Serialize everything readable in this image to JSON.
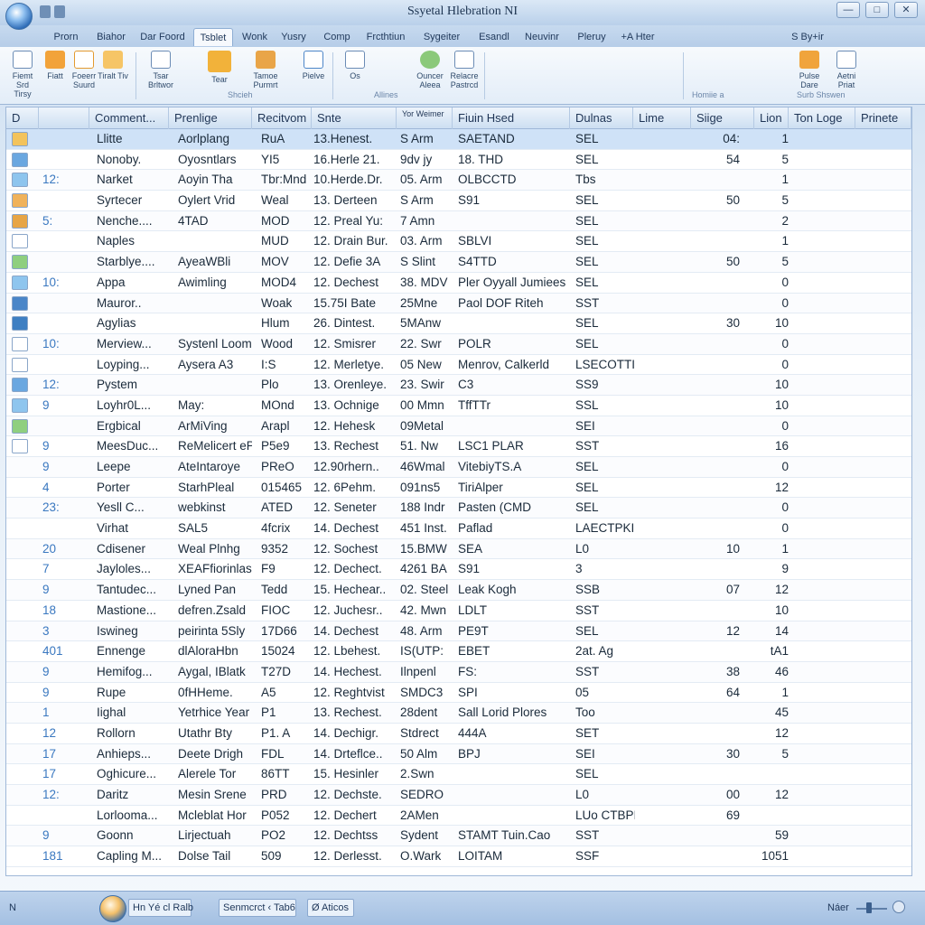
{
  "window": {
    "title": "Ssyetal Hlebration NI",
    "controls": [
      "—",
      "□",
      "✕"
    ]
  },
  "tabs": [
    {
      "label": "Prorn",
      "active": false
    },
    {
      "label": "Biahor",
      "active": false
    },
    {
      "label": "Dar Foord",
      "active": false
    },
    {
      "label": "Tsblet",
      "active": true
    },
    {
      "label": "Wonk",
      "active": false
    },
    {
      "label": "Yusry",
      "active": false
    },
    {
      "label": "Comp",
      "active": false
    },
    {
      "label": "Frcthtiun",
      "active": false
    },
    {
      "label": "Sygeiter",
      "active": false
    },
    {
      "label": "Esandl",
      "active": false
    },
    {
      "label": "Neuvinr",
      "active": false
    },
    {
      "label": "Pleruy",
      "active": false
    },
    {
      "label": "+A Hter",
      "active": false
    },
    {
      "label": "S By+ir",
      "active": false
    }
  ],
  "ribbon": {
    "buttons": [
      {
        "label": "Fiemt Srd Tirsy",
        "icon": "document-icon"
      },
      {
        "label": "Fiatt",
        "icon": "pointer-icon"
      },
      {
        "label": "Foeerr Suurd",
        "icon": "sheet-icon"
      },
      {
        "label": "Tiralt Tiv",
        "icon": "table-icon"
      },
      {
        "label": "Tsar Brltwor",
        "icon": "chart-icon"
      },
      {
        "label": "Tear",
        "icon": "folder-icon"
      },
      {
        "label": "Tamoe Purmrt",
        "icon": "gear-icon"
      },
      {
        "label": "Pielve",
        "icon": "pen-icon"
      },
      {
        "label": "Os",
        "icon": "select-icon"
      },
      {
        "label": "Ouncer Aleea",
        "icon": "globe-icon"
      },
      {
        "label": "Relacre Pastrcd",
        "icon": "clipboard-icon"
      },
      {
        "label": "Pulse Dare",
        "icon": "wand-icon"
      },
      {
        "label": "Aetni Priat",
        "icon": "print-icon"
      }
    ],
    "groups": [
      "Shcieh",
      "Allines",
      "Homiie a",
      "Surb Shswen"
    ]
  },
  "grid": {
    "columns": [
      "D",
      "Comment...",
      "Prenlige",
      "Recitvom",
      "Snte",
      "Yor Weimer",
      "Fiuin Hsed",
      "Dulnas",
      "Lime",
      "Siige",
      "Lion",
      "Ton Loge",
      "Prinete"
    ],
    "rows": [
      {
        "idx": "",
        "name": "Llitte",
        "c2": "Aorlplang",
        "c3": "RuA",
        "date": "13.Henest.",
        "c5": "S Arm",
        "c6": "SAETAND",
        "c7": "SEL",
        "c8": "",
        "c9": "04:",
        "c10": "1",
        "icon": "folder-icon",
        "selected": true
      },
      {
        "idx": "",
        "name": "Nonoby.",
        "c2": "Oyosntlars",
        "c3": "YI5",
        "date": "16.Herle 21.",
        "c5": "9dv jy",
        "c6": "18. THD",
        "c7": "SEL",
        "c8": "",
        "c9": "54",
        "c10": "5",
        "icon": "globe-icon",
        "selected": false
      },
      {
        "idx": "12:",
        "name": "Narket",
        "c2": "Aoyin Tha",
        "c3": "Tbr:Mnd",
        "date": "10.Herde.Dr.",
        "c5": "05. Arm",
        "c6": "OLBCCTD",
        "c7": "Tbs",
        "c8": "",
        "c9": "",
        "c10": "1",
        "icon": "chart-icon",
        "selected": false
      },
      {
        "idx": "",
        "name": "Syrtecer",
        "c2": "Oylert Vrid",
        "c3": "Weal",
        "date": "13. Derteen",
        "c5": "S Arm",
        "c6": "S91",
        "c7": "SEL",
        "c8": "",
        "c9": "50",
        "c10": "5",
        "icon": "user-icon",
        "selected": false
      },
      {
        "idx": "5:",
        "name": "Nenche....",
        "c2": "4TAD",
        "c3": "MOD",
        "date": "12. Preal Yu:",
        "c5": "7 Amn",
        "c6": "",
        "c7": "SEL",
        "c8": "",
        "c9": "",
        "c10": "2",
        "icon": "gear-icon",
        "selected": false
      },
      {
        "idx": "",
        "name": "Naples",
        "c2": "",
        "c3": "MUD",
        "date": "12. Drain Bur.",
        "c5": "03. Arm",
        "c6": "SBLVI",
        "c7": "SEL",
        "c8": "",
        "c9": "",
        "c10": "1",
        "icon": "sheet-icon",
        "selected": false
      },
      {
        "idx": "",
        "name": "Starblye....",
        "c2": "AyeaWBli",
        "c3": "MOV",
        "date": "12. Defie 3A",
        "c5": "S Slint",
        "c6": "S4TTD",
        "c7": "SEL",
        "c8": "",
        "c9": "50",
        "c10": "5",
        "icon": "table-icon",
        "selected": false
      },
      {
        "idx": "10:",
        "name": "Appa",
        "c2": "Awimling",
        "c3": "MOD4",
        "date": "12. Dechest",
        "c5": "38. MDV",
        "c6": "Pler Oyyall Jumiees",
        "c7": "SEL",
        "c8": "",
        "c9": "",
        "c10": "0",
        "icon": "chart-icon",
        "selected": false
      },
      {
        "idx": "",
        "name": "Mauror..",
        "c2": "",
        "c3": "Woak",
        "date": "15.75I Bate",
        "c5": "25Mne",
        "c6": "Paol DOF Riteh",
        "c7": "SST",
        "c8": "",
        "c9": "",
        "c10": "0",
        "icon": "book-icon",
        "selected": false
      },
      {
        "idx": "",
        "name": "Agylias",
        "c2": "",
        "c3": "Hlum",
        "date": "26. Dintest.",
        "c5": "5MAnw",
        "c6": "",
        "c7": "SEL",
        "c8": "",
        "c9": "30",
        "c10": "10",
        "icon": "pen-icon",
        "selected": false
      },
      {
        "idx": "10:",
        "name": "Merview...",
        "c2": "Systenl Loom",
        "c3": "Wood",
        "date": "12. Smisrer",
        "c5": "22. Swr",
        "c6": "POLR",
        "c7": "SEL",
        "c8": "",
        "c9": "",
        "c10": "0",
        "icon": "sheet-icon",
        "selected": false
      },
      {
        "idx": "",
        "name": "Loyping...",
        "c2": "Aysera A3",
        "c3": "I:S",
        "date": "12. Merletye.",
        "c5": "05 New",
        "c6": "Menrov, Calkerld",
        "c7": "LSECOTTI",
        "c8": "",
        "c9": "",
        "c10": "0",
        "icon": "document-icon",
        "selected": false
      },
      {
        "idx": "12:",
        "name": "Pystem",
        "c2": "",
        "c3": "Plo",
        "date": "13. Orenleye.",
        "c5": "23. Swir",
        "c6": "C3",
        "c7": "SS9",
        "c8": "",
        "c9": "",
        "c10": "10",
        "icon": "globe-icon",
        "selected": false
      },
      {
        "idx": "9",
        "name": "Loyhr0L...",
        "c2": "May:",
        "c3": "MOnd",
        "date": "13. Ochnige",
        "c5": "00 Mmn",
        "c6": "TffTTr",
        "c7": "SSL",
        "c8": "",
        "c9": "",
        "c10": "10",
        "icon": "chart-icon",
        "selected": false
      },
      {
        "idx": "",
        "name": "Ergbical",
        "c2": "ArMiVing",
        "c3": "Arapl",
        "date": "12. Hehesk",
        "c5": "09Metal",
        "c6": "",
        "c7": "SEI",
        "c8": "",
        "c9": "",
        "c10": "0",
        "icon": "table-icon",
        "selected": false
      },
      {
        "idx": "9",
        "name": "MeesDuc...",
        "c2": "ReMelicert eP",
        "c3": "P5e9",
        "date": "13. Rechest",
        "c5": "51. Nw",
        "c6": "LSC1 PLAR",
        "c7": "SST",
        "c8": "",
        "c9": "",
        "c10": "16",
        "icon": "document-icon",
        "selected": false
      },
      {
        "idx": "9",
        "name": "Leepe",
        "c2": "AteIntaroye",
        "c3": "PReO",
        "date": "12.90rhern..",
        "c5": "46Wmal",
        "c6": "VitebiyTS.A",
        "c7": "SEL",
        "c8": "",
        "c9": "",
        "c10": "0",
        "icon": "",
        "selected": false
      },
      {
        "idx": "4",
        "name": "Porter",
        "c2": "StarhPleal",
        "c3": "015465",
        "date": "12. 6Pehm.",
        "c5": "091ns5",
        "c6": "TiriAlper",
        "c7": "SEL",
        "c8": "",
        "c9": "",
        "c10": "12",
        "icon": "",
        "selected": false
      },
      {
        "idx": "23:",
        "name": "Yesll C...",
        "c2": "webkinst",
        "c3": "ATED",
        "date": "12. Seneter",
        "c5": "188 Indr",
        "c6": "Pasten (CMD",
        "c7": "SEL",
        "c8": "",
        "c9": "",
        "c10": "0",
        "icon": "",
        "selected": false
      },
      {
        "idx": "",
        "name": "Virhat",
        "c2": "SAL5",
        "c3": "4fcrix",
        "date": "14. Dechest",
        "c5": "451 Inst.",
        "c6": "Paflad",
        "c7": "LAECTPKI",
        "c8": "",
        "c9": "",
        "c10": "0",
        "icon": "",
        "selected": false
      },
      {
        "idx": "20",
        "name": "Cdisener",
        "c2": "Weal Plnhg",
        "c3": "9352",
        "date": "12. Sochest",
        "c5": "15.BMW",
        "c6": "SEA",
        "c7": "L0",
        "c8": "",
        "c9": "10",
        "c10": "1",
        "icon": "",
        "selected": false
      },
      {
        "idx": "7",
        "name": "Jayloles...",
        "c2": "XEAFfiorinlas",
        "c3": "F9",
        "date": "12. Dechect.",
        "c5": "4261 BA",
        "c6": "S91",
        "c7": "3",
        "c8": "",
        "c9": "",
        "c10": "9",
        "icon": "",
        "selected": false
      },
      {
        "idx": "9",
        "name": "Tantudec...",
        "c2": "Lyned Pan",
        "c3": "Tedd",
        "date": "15. Hechear..",
        "c5": "02. Steel",
        "c6": "Leak Kogh",
        "c7": "SSB",
        "c8": "",
        "c9": "07",
        "c10": "12",
        "icon": "",
        "selected": false
      },
      {
        "idx": "18",
        "name": "Mastione...",
        "c2": "defren.Zsald",
        "c3": "FIOC",
        "date": "12. Juchesr..",
        "c5": "42. Mwn",
        "c6": "LDLT",
        "c7": "SST",
        "c8": "",
        "c9": "",
        "c10": "10",
        "icon": "",
        "selected": false
      },
      {
        "idx": "3",
        "name": "Iswineg",
        "c2": "peirinta 5Sly",
        "c3": "17D66",
        "date": "14. Dechest",
        "c5": "48. Arm",
        "c6": "PE9T",
        "c7": "SEL",
        "c8": "",
        "c9": "12",
        "c10": "14",
        "icon": "",
        "selected": false
      },
      {
        "idx": "401",
        "name": "Ennenge",
        "c2": "dlAloraHbn",
        "c3": "15024",
        "date": "12. Lbehest.",
        "c5": "IS(UTP:",
        "c6": "EBET",
        "c7": "2at. Ag",
        "c8": "",
        "c9": "",
        "c10": "tA1",
        "icon": "",
        "selected": false
      },
      {
        "idx": "9",
        "name": "Hemifog...",
        "c2": "Aygal, IBlatk",
        "c3": "T27D",
        "date": "14. Hechest.",
        "c5": "Ilnpenl",
        "c6": "FS:",
        "c7": "SST",
        "c8": "",
        "c9": "38",
        "c10": "46",
        "icon": "",
        "selected": false
      },
      {
        "idx": "9",
        "name": "Rupe",
        "c2": "0fHHeme.",
        "c3": "A5",
        "date": "12. Reghtvist",
        "c5": "SMDC3",
        "c6": "SPI",
        "c7": "05",
        "c8": "",
        "c9": "64",
        "c10": "1",
        "icon": "",
        "selected": false
      },
      {
        "idx": "1",
        "name": "Iighal",
        "c2": "Yetrhice Year",
        "c3": "P1",
        "date": "13. Rechest.",
        "c5": "28dent",
        "c6": "Sall Lorid Plores",
        "c7": "Too",
        "c8": "",
        "c9": "",
        "c10": "45",
        "icon": "",
        "selected": false
      },
      {
        "idx": "12",
        "name": "Rollorn",
        "c2": "Utathr Bty",
        "c3": "P1. A",
        "date": "14. Dechigr.",
        "c5": "Stdrect",
        "c6": "444A",
        "c7": "SET",
        "c8": "",
        "c9": "",
        "c10": "12",
        "icon": "",
        "selected": false
      },
      {
        "idx": "17",
        "name": "Anhieps...",
        "c2": "Deete Drigh",
        "c3": "FDL",
        "date": "14. Drteflce..",
        "c5": "50 Alm",
        "c6": "BPJ",
        "c7": "SEI",
        "c8": "",
        "c9": "30",
        "c10": "5",
        "icon": "",
        "selected": false
      },
      {
        "idx": "17",
        "name": "Oghicure...",
        "c2": "Alerele Tor",
        "c3": "86TT",
        "date": "15. Hesinler",
        "c5": "2.Swn",
        "c6": "",
        "c7": "SEL",
        "c8": "",
        "c9": "",
        "c10": "",
        "icon": "",
        "selected": false
      },
      {
        "idx": "12:",
        "name": "Daritz",
        "c2": "Mesin Srene",
        "c3": "PRD",
        "date": "12. Dechste.",
        "c5": "SEDRO",
        "c6": "",
        "c7": "L0",
        "c8": "",
        "c9": "00",
        "c10": "12",
        "icon": "",
        "selected": false
      },
      {
        "idx": "",
        "name": "Lorlooma...",
        "c2": "Mcleblat Hor",
        "c3": "P052",
        "date": "12. Dechert",
        "c5": "2AMen",
        "c6": "",
        "c7": "LUo CTBPI",
        "c8": "",
        "c9": "69",
        "c10": "",
        "icon": "",
        "selected": false
      },
      {
        "idx": "9",
        "name": "Goonn",
        "c2": "Lirjectuah",
        "c3": "PO2",
        "date": "12. Dechtss",
        "c5": "Sydent",
        "c6": "STAMT Tuin.Cao",
        "c7": "SST",
        "c8": "",
        "c9": "",
        "c10": "59",
        "icon": "",
        "selected": false
      },
      {
        "idx": "181",
        "name": "Capling M...",
        "c2": "Dolse Tail",
        "c3": "509",
        "date": "12. Derlesst.",
        "c5": "O.Wark",
        "c6": "LOITAM",
        "c7": "SSF",
        "c8": "",
        "c9": "",
        "c10": "1051",
        "icon": "",
        "selected": false
      }
    ]
  },
  "statusbar": {
    "left": "N",
    "items": [
      "Hn Yé cl  Ralb",
      "Senmcrct  ‹ Tab6",
      "Ø Aticos"
    ],
    "zoom_label": "Náer",
    "zoom_level": 0.4
  }
}
